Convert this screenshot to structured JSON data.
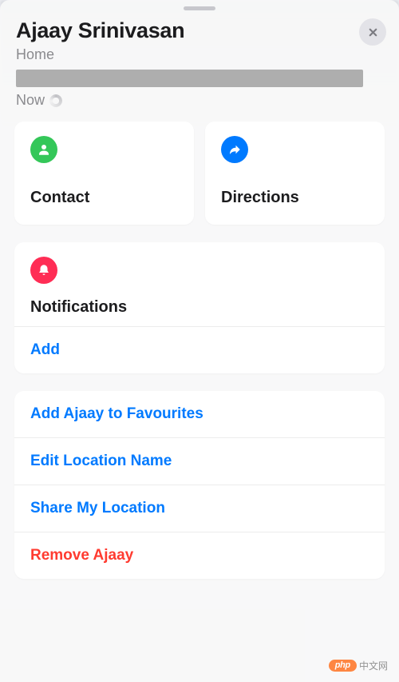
{
  "header": {
    "title": "Ajaay Srinivasan",
    "subtitle": "Home",
    "status": "Now"
  },
  "cards": {
    "contact": {
      "label": "Contact"
    },
    "directions": {
      "label": "Directions"
    }
  },
  "notifications": {
    "title": "Notifications",
    "add_label": "Add"
  },
  "actions": {
    "favourites": "Add Ajaay to Favourites",
    "edit_name": "Edit Location Name",
    "share_location": "Share My Location",
    "remove": "Remove Ajaay"
  },
  "watermark": {
    "pill": "php",
    "text": "中文网"
  }
}
